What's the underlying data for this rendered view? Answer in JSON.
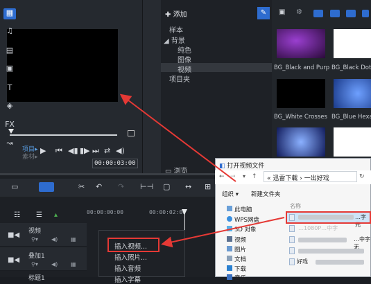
{
  "preview": {
    "mode_project": "项目▸",
    "mode_clip": "素材▸",
    "timecode": "00:00:03:00"
  },
  "library": {
    "add_label": "添加",
    "tree": [
      "样本",
      "背景",
      "纯色",
      "图像",
      "视频",
      "项目夹"
    ],
    "browse_label": "浏览"
  },
  "thumbnails": [
    {
      "label": "BG_Black and Purple",
      "color": "#4a1d6a"
    },
    {
      "label": "BG_Black Dots",
      "color": "#ffffff"
    },
    {
      "label": "BG_White Crosses",
      "color": "#000000"
    },
    {
      "label": "BG_Blue Hexagon",
      "color": "#3f6fd0"
    },
    {
      "label": "",
      "color": "#2a3a8a"
    },
    {
      "label": "",
      "color": "#ffffff"
    }
  ],
  "timeline": {
    "ruler": [
      "00:00:00:00",
      "00:00:02:00"
    ],
    "tracks": [
      "视频",
      "叠加1",
      "标题1"
    ]
  },
  "context_menu": {
    "items": [
      "插入视频...",
      "插入照片...",
      "插入音频",
      "插入字幕"
    ]
  },
  "dialog": {
    "title": "打开视频文件",
    "path": [
      "迅雷下载",
      "一出好戏"
    ],
    "organize": "组织 ▾",
    "new_folder": "新建文件夹",
    "column": "名称",
    "nav": [
      "此电脑",
      "WPS网盘",
      "3D 对象",
      "视频",
      "图片",
      "文档",
      "下载",
      "音乐"
    ],
    "files": [
      "…字元",
      "…1080P…中字",
      "…中字无",
      "…",
      "好戏"
    ]
  },
  "colors": {
    "accent": "#2e6ccf",
    "annotation": "#e53935"
  }
}
